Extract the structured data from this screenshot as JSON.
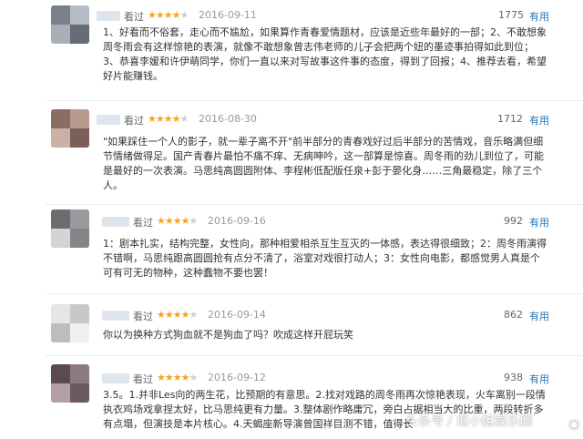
{
  "colors": {
    "star_on": "#f3a51f",
    "useful_link": "#2775b6",
    "date": "#9a9a9a"
  },
  "reviews": [
    {
      "seen": "看过",
      "stars": 4,
      "date": "2016-09-11",
      "votes": "1775",
      "useful": "有用",
      "lines": [
        "1、好看而不俗套，走心而不尴尬，如果算作青春爱情题材，应该是近些年最好的一部；2、不敢想象",
        "周冬雨会有这样惊艳的表演，就像不敢想象曾志伟老师的儿子会把两个妞的墨迹事拍得如此到位；",
        "3、恭喜李媛和许伊萌同学，你们一直以来对写故事这件事的态度，得到了回报；4、推荐去看，希望",
        "好片能赚钱。"
      ]
    },
    {
      "seen": "看过",
      "stars": 4,
      "date": "2016-08-30",
      "votes": "1712",
      "useful": "有用",
      "lines": [
        "\"如果踩住一个人的影子，就一辈子离不开\"前半部分的青春戏好过后半部分的苦情戏，音乐略满但细",
        "节情绪做得足。国产青春片最怕不痛不痒、无病呻吟，这一部算是惊喜。周冬雨的劲儿到位了，可能",
        "是最好的一次表演。马思纯高圆圆附体、李程彬低配版任泉+彭于晏化身……三角最稳定，除了三个",
        "人。"
      ]
    },
    {
      "seen": "看过",
      "stars": 4,
      "date": "2016-09-16",
      "votes": "992",
      "useful": "有用",
      "lines": [
        "1：剧本扎实，结构完整，女性向，那种相爱相杀互生互灭的一体感，表达得很细致；2：周冬雨演得",
        "不错啊，马思纯跟高圆圆抢有点分不清了，浴室对戏很打动人；3：女性向电影，都感觉男人真是个",
        "可有可无的物种，这种蠢物不要也罢！"
      ]
    },
    {
      "seen": "看过",
      "stars": 4,
      "date": "2016-09-14",
      "votes": "862",
      "useful": "有用",
      "lines": [
        "你以为换种方式狗血就不是狗血了吗？吹成这样开屁玩笑"
      ]
    },
    {
      "seen": "看过",
      "stars": 4,
      "date": "2016-09-12",
      "votes": "938",
      "useful": "有用",
      "lines": [
        "3.5。1.并非Les向的两生花，比预期的有意思。2.找对戏路的周冬雨再次惊艳表现，火车离别一段情",
        "执衣鸡场戏拿捏太好，比马思纯更有力量。3.整体剧作略庸冗，旁白占据相当大的比重，两段转折多",
        "有点塌，但演技是本片核心。4.天蝎座新导演曾国祥目测不错，值得长"
      ]
    }
  ],
  "watermark": "头条号 / 逗小姐娱乐圈"
}
